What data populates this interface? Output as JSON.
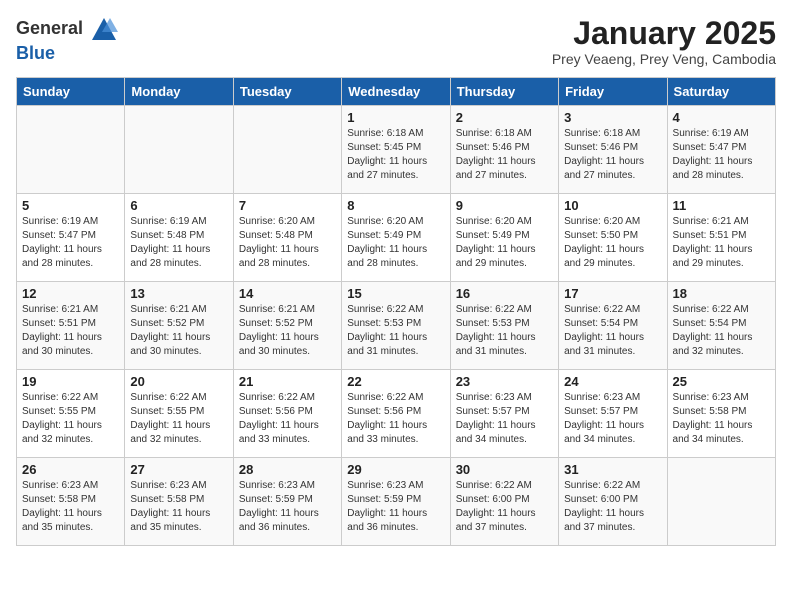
{
  "header": {
    "logo_general": "General",
    "logo_blue": "Blue",
    "month_title": "January 2025",
    "subtitle": "Prey Veaeng, Prey Veng, Cambodia"
  },
  "days_of_week": [
    "Sunday",
    "Monday",
    "Tuesday",
    "Wednesday",
    "Thursday",
    "Friday",
    "Saturday"
  ],
  "weeks": [
    [
      {
        "day": "",
        "info": "",
        "empty": true
      },
      {
        "day": "",
        "info": "",
        "empty": true
      },
      {
        "day": "",
        "info": "",
        "empty": true
      },
      {
        "day": "1",
        "info": "Sunrise: 6:18 AM\nSunset: 5:45 PM\nDaylight: 11 hours\nand 27 minutes."
      },
      {
        "day": "2",
        "info": "Sunrise: 6:18 AM\nSunset: 5:46 PM\nDaylight: 11 hours\nand 27 minutes."
      },
      {
        "day": "3",
        "info": "Sunrise: 6:18 AM\nSunset: 5:46 PM\nDaylight: 11 hours\nand 27 minutes."
      },
      {
        "day": "4",
        "info": "Sunrise: 6:19 AM\nSunset: 5:47 PM\nDaylight: 11 hours\nand 28 minutes."
      }
    ],
    [
      {
        "day": "5",
        "info": "Sunrise: 6:19 AM\nSunset: 5:47 PM\nDaylight: 11 hours\nand 28 minutes."
      },
      {
        "day": "6",
        "info": "Sunrise: 6:19 AM\nSunset: 5:48 PM\nDaylight: 11 hours\nand 28 minutes."
      },
      {
        "day": "7",
        "info": "Sunrise: 6:20 AM\nSunset: 5:48 PM\nDaylight: 11 hours\nand 28 minutes."
      },
      {
        "day": "8",
        "info": "Sunrise: 6:20 AM\nSunset: 5:49 PM\nDaylight: 11 hours\nand 28 minutes."
      },
      {
        "day": "9",
        "info": "Sunrise: 6:20 AM\nSunset: 5:49 PM\nDaylight: 11 hours\nand 29 minutes."
      },
      {
        "day": "10",
        "info": "Sunrise: 6:20 AM\nSunset: 5:50 PM\nDaylight: 11 hours\nand 29 minutes."
      },
      {
        "day": "11",
        "info": "Sunrise: 6:21 AM\nSunset: 5:51 PM\nDaylight: 11 hours\nand 29 minutes."
      }
    ],
    [
      {
        "day": "12",
        "info": "Sunrise: 6:21 AM\nSunset: 5:51 PM\nDaylight: 11 hours\nand 30 minutes."
      },
      {
        "day": "13",
        "info": "Sunrise: 6:21 AM\nSunset: 5:52 PM\nDaylight: 11 hours\nand 30 minutes."
      },
      {
        "day": "14",
        "info": "Sunrise: 6:21 AM\nSunset: 5:52 PM\nDaylight: 11 hours\nand 30 minutes."
      },
      {
        "day": "15",
        "info": "Sunrise: 6:22 AM\nSunset: 5:53 PM\nDaylight: 11 hours\nand 31 minutes."
      },
      {
        "day": "16",
        "info": "Sunrise: 6:22 AM\nSunset: 5:53 PM\nDaylight: 11 hours\nand 31 minutes."
      },
      {
        "day": "17",
        "info": "Sunrise: 6:22 AM\nSunset: 5:54 PM\nDaylight: 11 hours\nand 31 minutes."
      },
      {
        "day": "18",
        "info": "Sunrise: 6:22 AM\nSunset: 5:54 PM\nDaylight: 11 hours\nand 32 minutes."
      }
    ],
    [
      {
        "day": "19",
        "info": "Sunrise: 6:22 AM\nSunset: 5:55 PM\nDaylight: 11 hours\nand 32 minutes."
      },
      {
        "day": "20",
        "info": "Sunrise: 6:22 AM\nSunset: 5:55 PM\nDaylight: 11 hours\nand 32 minutes."
      },
      {
        "day": "21",
        "info": "Sunrise: 6:22 AM\nSunset: 5:56 PM\nDaylight: 11 hours\nand 33 minutes."
      },
      {
        "day": "22",
        "info": "Sunrise: 6:22 AM\nSunset: 5:56 PM\nDaylight: 11 hours\nand 33 minutes."
      },
      {
        "day": "23",
        "info": "Sunrise: 6:23 AM\nSunset: 5:57 PM\nDaylight: 11 hours\nand 34 minutes."
      },
      {
        "day": "24",
        "info": "Sunrise: 6:23 AM\nSunset: 5:57 PM\nDaylight: 11 hours\nand 34 minutes."
      },
      {
        "day": "25",
        "info": "Sunrise: 6:23 AM\nSunset: 5:58 PM\nDaylight: 11 hours\nand 34 minutes."
      }
    ],
    [
      {
        "day": "26",
        "info": "Sunrise: 6:23 AM\nSunset: 5:58 PM\nDaylight: 11 hours\nand 35 minutes."
      },
      {
        "day": "27",
        "info": "Sunrise: 6:23 AM\nSunset: 5:58 PM\nDaylight: 11 hours\nand 35 minutes."
      },
      {
        "day": "28",
        "info": "Sunrise: 6:23 AM\nSunset: 5:59 PM\nDaylight: 11 hours\nand 36 minutes."
      },
      {
        "day": "29",
        "info": "Sunrise: 6:23 AM\nSunset: 5:59 PM\nDaylight: 11 hours\nand 36 minutes."
      },
      {
        "day": "30",
        "info": "Sunrise: 6:22 AM\nSunset: 6:00 PM\nDaylight: 11 hours\nand 37 minutes."
      },
      {
        "day": "31",
        "info": "Sunrise: 6:22 AM\nSunset: 6:00 PM\nDaylight: 11 hours\nand 37 minutes."
      },
      {
        "day": "",
        "info": "",
        "empty": true
      }
    ]
  ]
}
